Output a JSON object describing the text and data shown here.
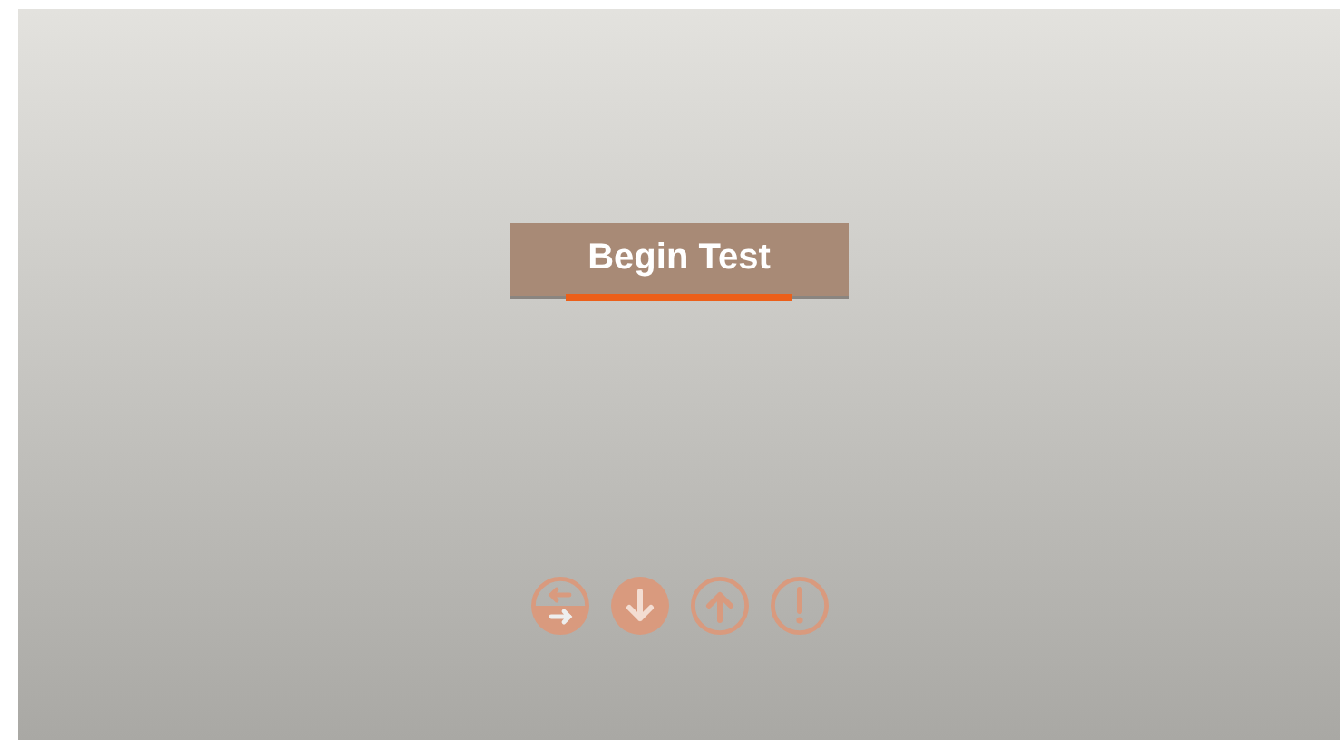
{
  "start_button": {
    "label": "Begin Test"
  },
  "actions": [
    {
      "kind": "swap",
      "selected": false
    },
    {
      "kind": "download",
      "selected": true
    },
    {
      "kind": "upload",
      "selected": false
    },
    {
      "kind": "alert",
      "selected": false
    }
  ]
}
